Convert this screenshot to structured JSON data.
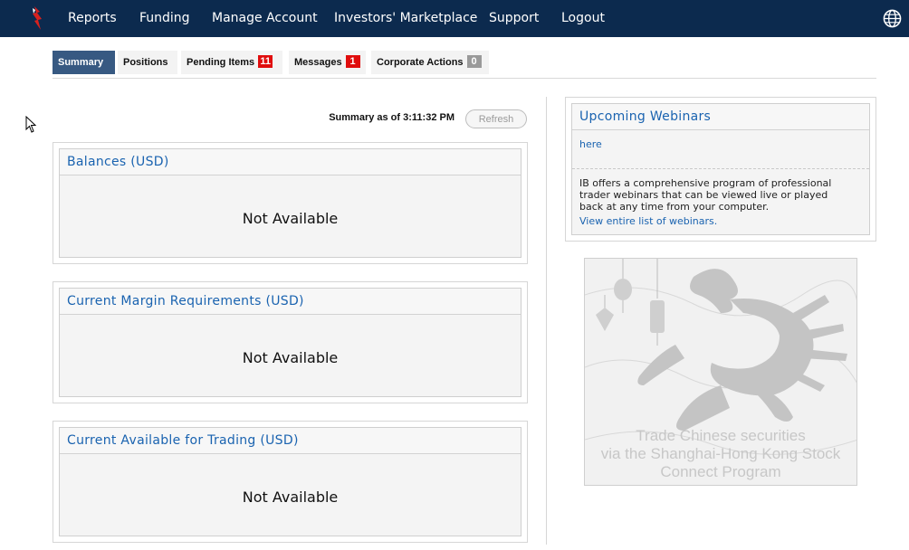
{
  "nav": {
    "items": [
      "Reports",
      "Funding",
      "Manage Account",
      "Investors' Marketplace",
      "Support",
      "Logout"
    ]
  },
  "tabs": [
    {
      "label": "Summary",
      "badge": null
    },
    {
      "label": "Positions",
      "badge": null
    },
    {
      "label": "Pending Items",
      "badge": "11"
    },
    {
      "label": "Messages",
      "badge": "1"
    },
    {
      "label": "Corporate Actions",
      "badge": "0"
    }
  ],
  "summary": {
    "as_of": "Summary as of 3:11:32 PM",
    "refresh_label": "Refresh"
  },
  "panels": [
    {
      "title": "Balances (USD)",
      "value": "Not Available"
    },
    {
      "title": "Current Margin Requirements (USD)",
      "value": "Not Available"
    },
    {
      "title": "Current Available for Trading (USD)",
      "value": "Not Available"
    }
  ],
  "webinars": {
    "title": "Upcoming Webinars",
    "here_link": "here",
    "description": "IB offers a comprehensive program of professional trader webinars that can be viewed live or played back at any time from your computer.",
    "list_link": "View entire list of webinars."
  },
  "ad": {
    "lines": [
      "Trade Chinese securities",
      "via the Shanghai-Hong Kong Stock",
      "Connect Program"
    ]
  },
  "colors": {
    "topbar": "#0c2a4e",
    "active_tab": "#375982",
    "link": "#1a63b0",
    "badge_red": "#e00d0d",
    "badge_gray": "#9a9a9a"
  }
}
